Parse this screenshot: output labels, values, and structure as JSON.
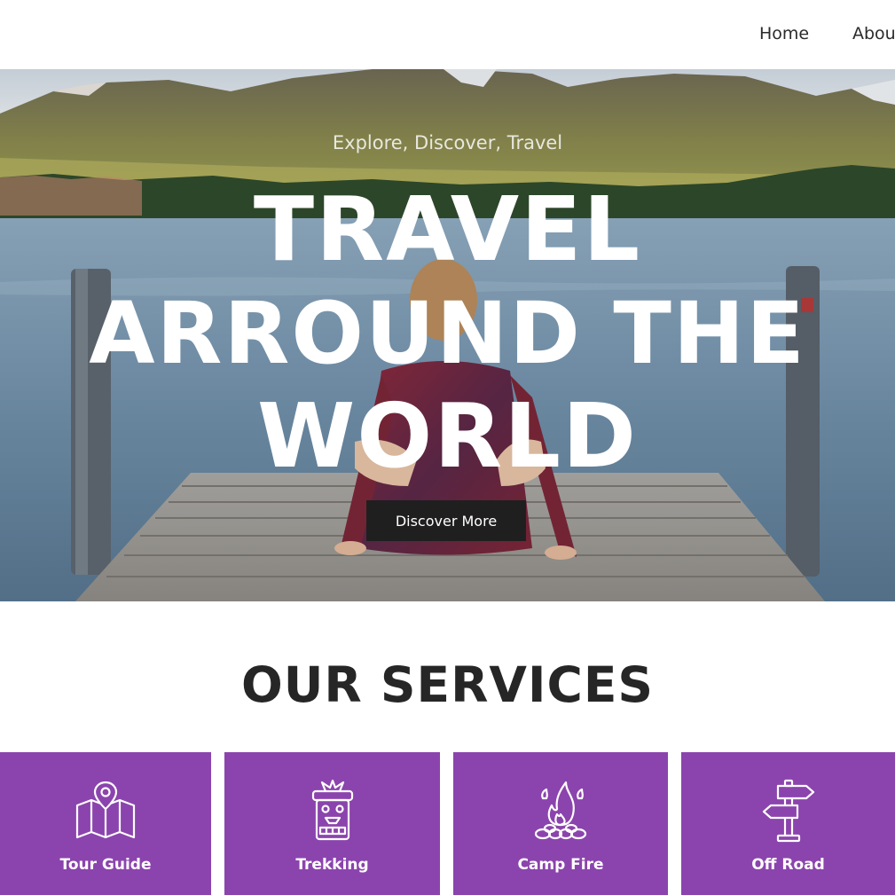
{
  "nav": {
    "items": [
      {
        "label": "Home"
      },
      {
        "label": "Abou"
      }
    ]
  },
  "hero": {
    "tagline": "Explore, Discover, Travel",
    "title_lines": [
      "TRAVEL",
      "ARROUND THE",
      "WORLD"
    ],
    "button_label": "Discover More"
  },
  "services": {
    "title": "OUR SERVICES",
    "accent_color": "#8b44ad",
    "items": [
      {
        "label": "Tour Guide",
        "icon": "map-pin-icon"
      },
      {
        "label": "Trekking",
        "icon": "totem-icon"
      },
      {
        "label": "Camp Fire",
        "icon": "campfire-icon"
      },
      {
        "label": "Off Road",
        "icon": "signpost-icon"
      }
    ]
  }
}
